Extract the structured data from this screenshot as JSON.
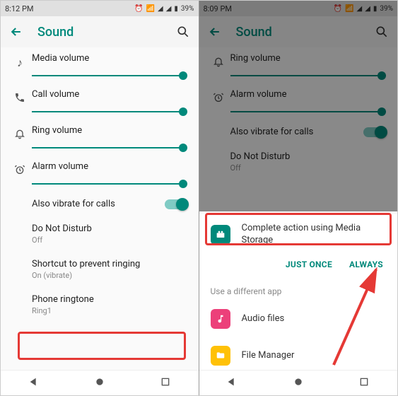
{
  "left": {
    "status": {
      "time": "8:12 PM",
      "battery": "39%"
    },
    "appbar": {
      "title": "Sound"
    },
    "sliders": {
      "media": {
        "label": "Media volume"
      },
      "call": {
        "label": "Call volume"
      },
      "ring": {
        "label": "Ring volume"
      },
      "alarm": {
        "label": "Alarm volume"
      }
    },
    "vibrate": {
      "label": "Also vibrate for calls"
    },
    "dnd": {
      "label": "Do Not Disturb",
      "sub": "Off"
    },
    "shortcut": {
      "label": "Shortcut to prevent ringing",
      "sub": "On (vibrate)"
    },
    "ringtone": {
      "label": "Phone ringtone",
      "sub": "Ring1"
    }
  },
  "right": {
    "status": {
      "time": "8:09 PM",
      "battery": "39%"
    },
    "appbar": {
      "title": "Sound"
    },
    "sliders": {
      "ring": {
        "label": "Ring volume"
      },
      "alarm": {
        "label": "Alarm volume"
      }
    },
    "vibrate": {
      "label": "Also vibrate for calls"
    },
    "dnd": {
      "label": "Do Not Disturb",
      "sub": "Off"
    },
    "sheet": {
      "primary": "Complete action using Media Storage",
      "just_once": "JUST ONCE",
      "always": "ALWAYS",
      "alt_label": "Use a different app",
      "apps": {
        "audio": "Audio files",
        "filemgr": "File Manager"
      }
    }
  }
}
